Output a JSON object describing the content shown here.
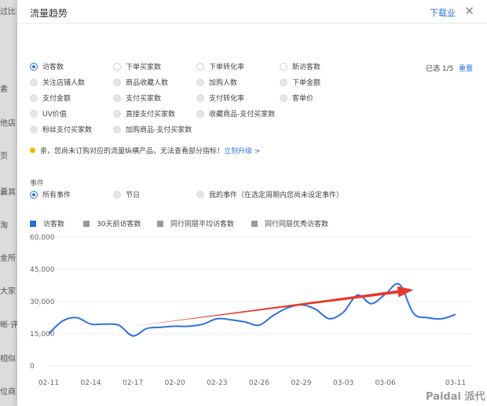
{
  "background": {
    "labels": [
      "过比",
      "素",
      "他店",
      "页",
      "囊其",
      "淘",
      "金所",
      "大家",
      "晰·评",
      "相似",
      "位商"
    ]
  },
  "modal": {
    "title": "流量趋势",
    "download_label": "下载业",
    "close_icon": "close-icon"
  },
  "metrics": [
    {
      "label": "访客数",
      "checked": true
    },
    {
      "label": "下单买家数",
      "checked": false
    },
    {
      "label": "下单转化率",
      "checked": false
    },
    {
      "label": "新访客数",
      "checked": false
    },
    {
      "label": "关注店铺人数",
      "checked": false
    },
    {
      "label": "商品收藏人数",
      "checked": false
    },
    {
      "label": "加购人数",
      "checked": false
    },
    {
      "label": "下单金额",
      "checked": false
    },
    {
      "label": "支付金额",
      "checked": false
    },
    {
      "label": "支付买家数",
      "checked": false
    },
    {
      "label": "支付转化率",
      "checked": false
    },
    {
      "label": "客单价",
      "checked": false
    },
    {
      "label": "UV价值",
      "checked": false
    },
    {
      "label": "直接支付买家数",
      "checked": false
    },
    {
      "label": "收藏商品-支付买家数",
      "checked": false
    },
    {
      "label": "粉丝支付买家数",
      "checked": false
    },
    {
      "label": "加购商品-支付买家数",
      "checked": false
    }
  ],
  "selection": {
    "count_text": "已选 1/5",
    "reset_label": "重置"
  },
  "notice": {
    "text": "亲，您尚未订购对应的流量纵横产品，无法查看部分指标！",
    "link": "立刻升级 >"
  },
  "events": {
    "label": "事件",
    "options": [
      {
        "label": "所有事件",
        "checked": true
      },
      {
        "label": "节日",
        "checked": false
      },
      {
        "label": "我的事件（在选定周期内您尚未设定事件）",
        "checked": false
      }
    ]
  },
  "colors": {
    "accent": "#2d6cdf",
    "series_line": "#2f6fe0",
    "legend_gray": "#999999",
    "annotation_arrow": "#e8382b"
  },
  "chart_data": {
    "type": "line",
    "ylim": [
      0,
      60000
    ],
    "y_ticks": [
      "0",
      "15,000",
      "30,000",
      "45,000",
      "60,000"
    ],
    "x_ticks": [
      "02-11",
      "02-14",
      "02-17",
      "02-20",
      "02-23",
      "02-26",
      "02-29",
      "03-03",
      "03-06",
      "03-11"
    ],
    "legend": [
      {
        "name": "访客数",
        "color": "#2d6cdf"
      },
      {
        "name": "30天前访客数",
        "color": "#999999"
      },
      {
        "name": "同行同层平均访客数",
        "color": "#999999"
      },
      {
        "name": "同行同层优秀访客数",
        "color": "#999999"
      }
    ],
    "series": [
      {
        "name": "访客数",
        "x": [
          "02-11",
          "02-12",
          "02-13",
          "02-14",
          "02-15",
          "02-16",
          "02-17",
          "02-18",
          "02-19",
          "02-20",
          "02-21",
          "02-22",
          "02-23",
          "02-24",
          "02-25",
          "02-26",
          "02-27",
          "02-28",
          "02-29",
          "03-01",
          "03-02",
          "03-03",
          "03-04",
          "03-05",
          "03-06",
          "03-07",
          "03-08",
          "03-09",
          "03-10",
          "03-11"
        ],
        "values": [
          15000,
          21000,
          22500,
          19500,
          19500,
          19000,
          14000,
          17500,
          18000,
          18500,
          18500,
          19500,
          22000,
          21500,
          20500,
          19000,
          23500,
          27000,
          28500,
          26500,
          22000,
          25000,
          33000,
          29000,
          33500,
          38000,
          24500,
          22500,
          22000,
          24000
        ]
      }
    ],
    "annotation": {
      "type": "arrow",
      "from": [
        "02-17",
        18500
      ],
      "to": [
        "03-08",
        35500
      ]
    }
  },
  "watermark": {
    "text": "Paidai 派代"
  }
}
